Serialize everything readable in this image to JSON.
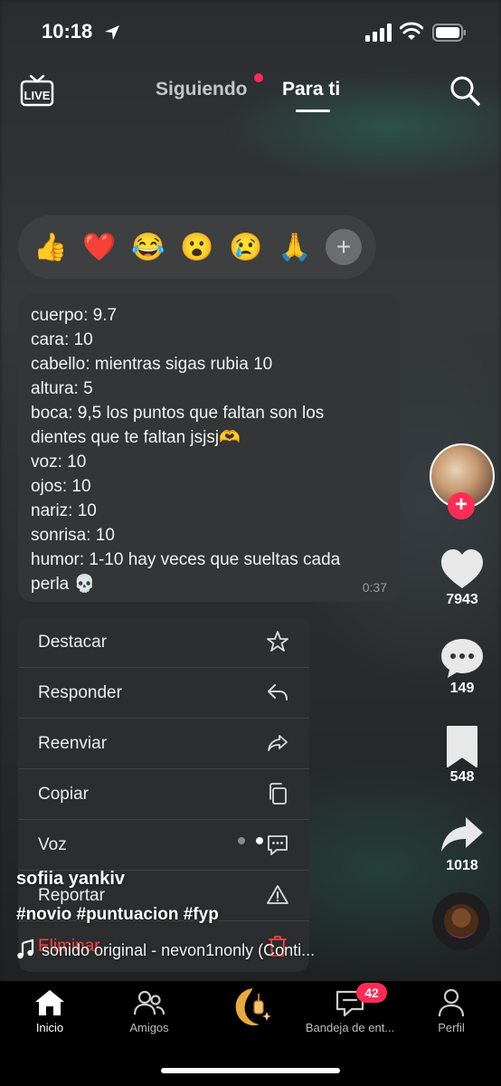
{
  "status_bar": {
    "time": "10:18"
  },
  "top_nav": {
    "live_label": "LIVE",
    "tabs": [
      {
        "label": "Siguiendo",
        "has_dot": true,
        "active": false
      },
      {
        "label": "Para ti",
        "active": true
      }
    ]
  },
  "reactions": {
    "items": [
      "👍",
      "❤️",
      "😂",
      "😮",
      "😢",
      "🙏"
    ],
    "more_label": "+"
  },
  "message": {
    "lines": [
      "cuerpo: 9.7",
      "cara: 10",
      "cabello: mientras sigas rubia 10",
      "altura: 5",
      "boca: 9,5 los puntos que faltan son los",
      "dientes que te faltan jsjsj🫶",
      "voz: 10",
      "ojos: 10",
      "nariz: 10",
      "sonrisa: 10",
      "humor: 1-10 hay veces que sueltas cada",
      "perla 💀"
    ],
    "time": "0:37"
  },
  "context_menu": {
    "items": [
      {
        "label": "Destacar",
        "icon": "star-icon"
      },
      {
        "label": "Responder",
        "icon": "reply-icon"
      },
      {
        "label": "Reenviar",
        "icon": "forward-icon"
      },
      {
        "label": "Copiar",
        "icon": "copy-icon"
      },
      {
        "label": "Voz",
        "icon": "voice-message-icon"
      },
      {
        "label": "Reportar",
        "icon": "warning-icon"
      },
      {
        "label": "Eliminar",
        "icon": "trash-icon",
        "danger": true
      }
    ]
  },
  "right_rail": {
    "follow_label": "+",
    "likes": "7943",
    "comments": "149",
    "saves": "548",
    "shares": "1018"
  },
  "caption": {
    "author": "sofiia yankiv",
    "hashtags": "#novio #puntuacion #fyp",
    "sound": "sonido original - nevon1nonly (Conti..."
  },
  "bottom_nav": {
    "items": [
      {
        "label": "Inicio",
        "active": true
      },
      {
        "label": "Amigos"
      },
      {
        "label": ""
      },
      {
        "label": "Bandeja de ent..."
      },
      {
        "label": "Perfil"
      }
    ],
    "inbox_badge": "42"
  },
  "colors": {
    "accent": "#fe2c55",
    "danger": "#ff4040",
    "background": "#000000"
  }
}
